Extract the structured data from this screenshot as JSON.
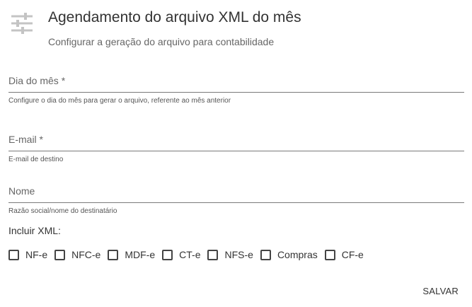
{
  "header": {
    "icon": "sliders-icon",
    "title": "Agendamento do arquivo XML do mês",
    "subtitle": "Configurar a geração do arquivo para contabilidade"
  },
  "fields": {
    "dia": {
      "placeholder": "Dia do mês *",
      "value": "",
      "hint": "Configure o dia do mês para gerar o arquivo, referente ao mês anterior"
    },
    "email": {
      "placeholder": "E-mail *",
      "value": "",
      "hint": "E-mail de destino"
    },
    "nome": {
      "placeholder": "Nome",
      "value": "",
      "hint": "Razão social/nome do destinatário"
    }
  },
  "xml": {
    "label": "Incluir XML:",
    "options": [
      {
        "label": "NF-e",
        "checked": false
      },
      {
        "label": "NFC-e",
        "checked": false
      },
      {
        "label": "MDF-e",
        "checked": false
      },
      {
        "label": "CT-e",
        "checked": false
      },
      {
        "label": "NFS-e",
        "checked": false
      },
      {
        "label": "Compras",
        "checked": false
      },
      {
        "label": "CF-e",
        "checked": false
      }
    ]
  },
  "actions": {
    "save_label": "SALVAR"
  },
  "colors": {
    "text": "#333333",
    "muted": "#666666",
    "underline": "#7a7a7a",
    "icon": "#c4c4c4"
  }
}
